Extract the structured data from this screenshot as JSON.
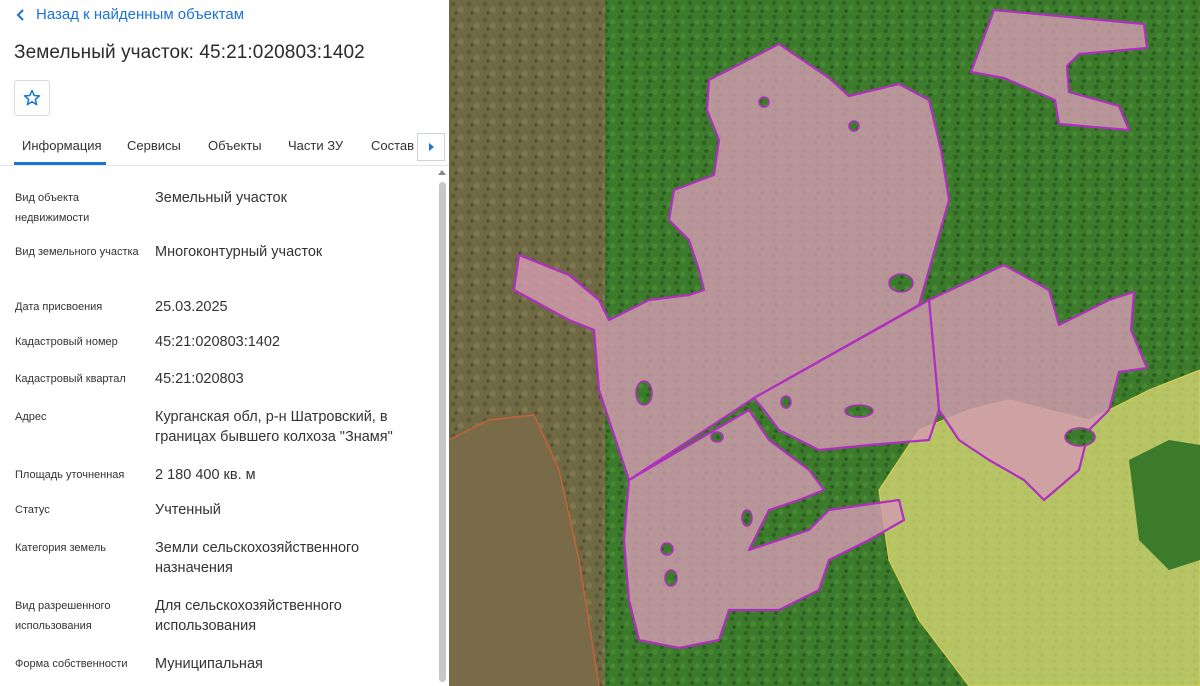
{
  "header": {
    "back_label": "Назад к найденным объектам",
    "title": "Земельный участок: 45:21:020803:1402"
  },
  "tabs": [
    {
      "label": "Информация"
    },
    {
      "label": "Сервисы"
    },
    {
      "label": "Объекты"
    },
    {
      "label": "Части ЗУ"
    },
    {
      "label": "Состав"
    }
  ],
  "details": [
    {
      "label": "Вид объекта недвижимости",
      "value": "Земельный участок"
    },
    {
      "label": "Вид земельного участка",
      "value": "Многоконтурный участок"
    },
    {
      "label": "Дата присвоения",
      "value": "25.03.2025"
    },
    {
      "label": "Кадастровый номер",
      "value": "45:21:020803:1402"
    },
    {
      "label": "Кадастровый квартал",
      "value": "45:21:020803"
    },
    {
      "label": "Адрес",
      "value": "Курганская обл, р-н Шатровский, в границах бывшего колхоза \"Знамя\""
    },
    {
      "label": "Площадь уточненная",
      "value": "2 180 400 кв. м"
    },
    {
      "label": "Статус",
      "value": "Учтенный"
    },
    {
      "label": "Категория земель",
      "value": "Земли сельскохозяйственного назначения"
    },
    {
      "label": "Вид разрешенного использования",
      "value": "Для сельскохозяйственного использования"
    },
    {
      "label": "Форма собственности",
      "value": "Муниципальная"
    }
  ],
  "colors": {
    "accent": "#1a73d9",
    "parcel_fill": "#d39bb0",
    "parcel_stroke": "#b02fc0",
    "adjacent_fill": "#e6e07a"
  },
  "icons": {
    "back": "chevron-left-icon",
    "favorite": "star-icon",
    "tab_scroll": "caret-right-icon"
  }
}
